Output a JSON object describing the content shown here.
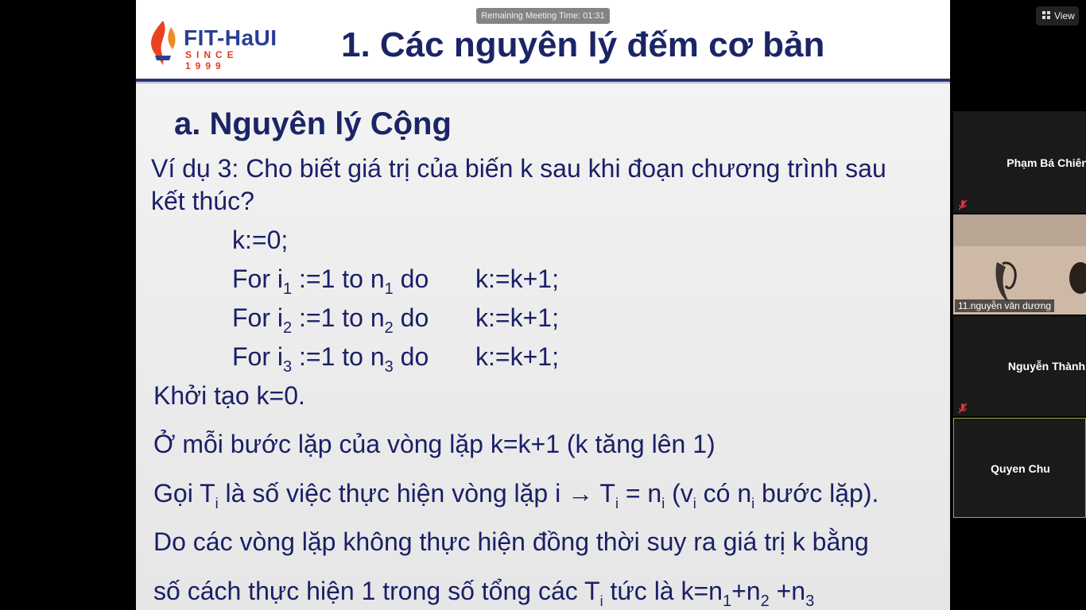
{
  "meeting": {
    "remaining_time": "Remaining Meeting Time: 01:31",
    "view_label": "View"
  },
  "slide": {
    "logo_brand": "FIT-HaUI",
    "logo_since": "SINCE 1999",
    "title": "1. Các nguyên lý đếm cơ bản",
    "section": "a. Nguyên lý Cộng",
    "example_line1": "Ví dụ 3: Cho biết giá trị của biến k sau khi đoạn chương trình sau",
    "example_line2": "kết thúc?",
    "code": {
      "init": "k:=0;",
      "for_prefix": "For i",
      "for_mid": " :=1 to n",
      "for_suffix": " do",
      "loop_body": "k:=k+1;",
      "indices": [
        "1",
        "2",
        "3"
      ]
    },
    "init_text": "Khởi tạo k=0.",
    "loop_text": "Ở mỗi bước lặp của vòng lặp k=k+1 (k tăng lên 1)",
    "goi": {
      "p1": "Gọi T",
      "sub_i": "i",
      "p2": "  là số việc thực hiện vòng lặp i → T",
      "p3": " = n",
      "p4": " (v",
      "p5": " có n",
      "p6": " bước lặp)."
    },
    "do_line1": "Do các vòng lặp không thực hiện đồng thời suy ra giá trị k bằng",
    "do_line2": {
      "p1": "số cách thực hiện 1 trong số tổng các T",
      "p2": " tức là k=n",
      "p3": "+n",
      "p4": " +n",
      "subs": [
        "i",
        "1",
        "2",
        "3"
      ]
    }
  },
  "participants": [
    {
      "name": "Phạm Bá Chiên",
      "muted": true
    },
    {
      "name": "11.nguyễn văn dương",
      "video": true
    },
    {
      "name": "Nguyễn  Thành.",
      "muted": true
    },
    {
      "name": "Quyen Chu",
      "active_speaker": true
    }
  ]
}
